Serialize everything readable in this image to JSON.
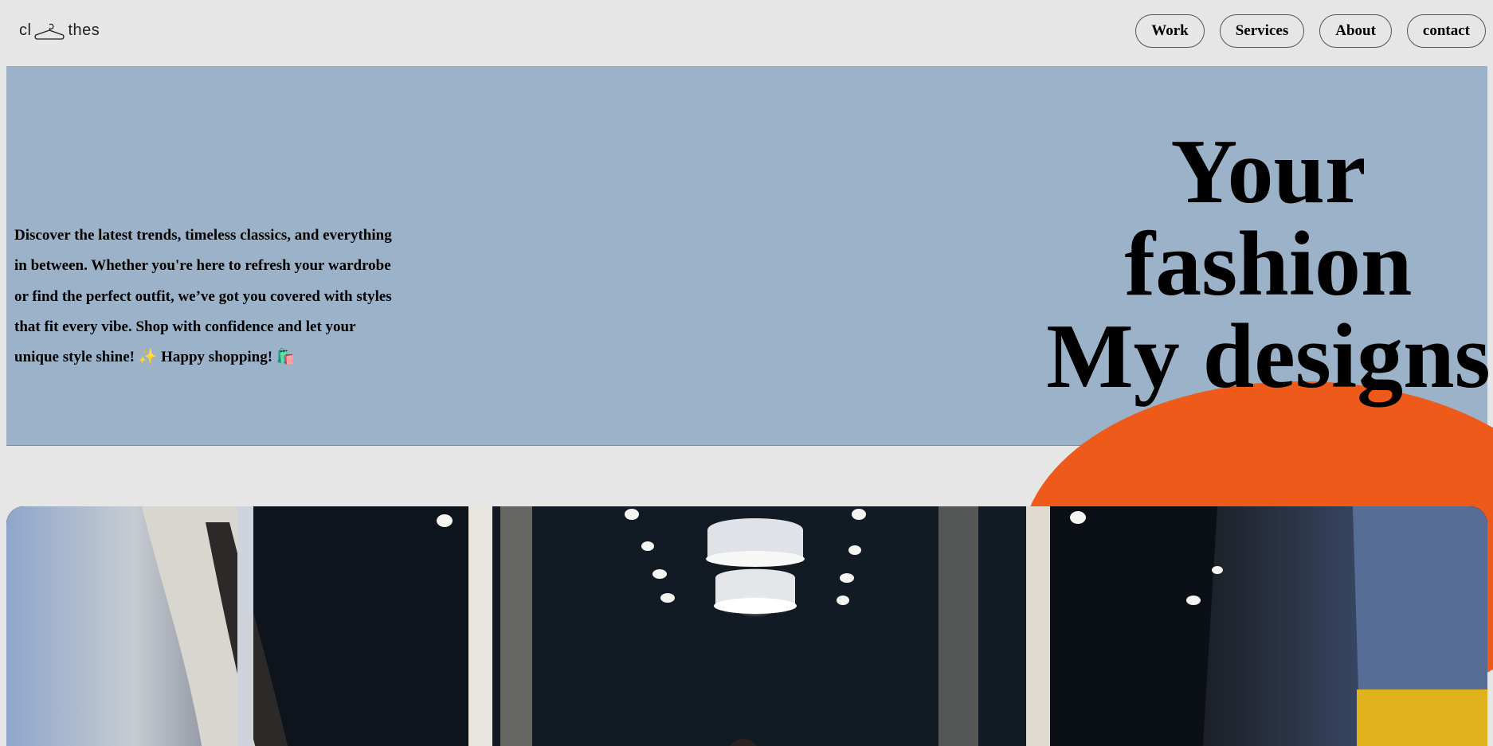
{
  "header": {
    "logo_left": "cl",
    "logo_right": "thes",
    "logo_icon": "hanger-icon"
  },
  "nav": {
    "items": [
      {
        "label": "Work"
      },
      {
        "label": "Services"
      },
      {
        "label": "About"
      },
      {
        "label": "contact"
      }
    ]
  },
  "hero": {
    "description": "Discover the latest trends, timeless classics, and everything in between. Whether you're here to refresh your wardrobe or find the perfect outfit, we’ve got you covered with styles that fit every vibe. Shop with confidence and let your unique style shine! ✨ Happy shopping! 🛍️",
    "title_line1": "Your",
    "title_line2": "fashion",
    "title_line3": "My designs"
  },
  "colors": {
    "page_bg": "#e6e6e6",
    "hero_bg": "#9cb2c8",
    "accent_orange": "#ee5a1a"
  },
  "photo": {
    "subject": "clothing-store-interior-photo"
  }
}
